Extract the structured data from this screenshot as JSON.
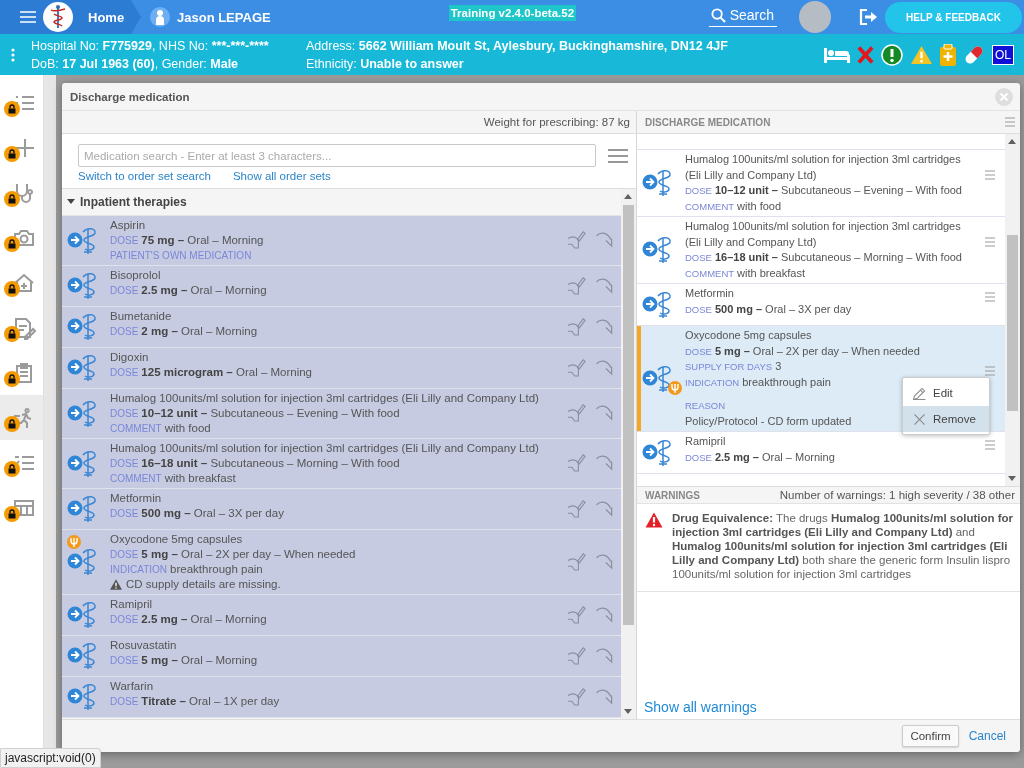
{
  "top_bar": {
    "home": "Home",
    "patient_name": "Jason LEPAGE",
    "version": "Training v2.4.0-beta.52",
    "search": "Search",
    "help_button": "HELP & FEEDBACK"
  },
  "patient_bar": {
    "columns": [
      {
        "lines": [
          [
            {
              "text": "Hospital No: ",
              "bold": false
            },
            {
              "text": "F775929",
              "bold": true
            },
            {
              "text": ", NHS No: ",
              "bold": false
            },
            {
              "text": "***-***-****",
              "bold": true
            }
          ],
          [
            {
              "text": "DoB: ",
              "bold": false
            },
            {
              "text": "17 Jul 1963 (60)",
              "bold": true
            },
            {
              "text": ", Gender: ",
              "bold": false
            },
            {
              "text": "Male",
              "bold": true
            }
          ]
        ]
      },
      {
        "lines": [
          [
            {
              "text": "Address: ",
              "bold": false
            },
            {
              "text": "5662 William Moult St, Aylesbury, Buckinghamshire, DN12 4JF",
              "bold": true
            }
          ],
          [
            {
              "text": "Ethnicity: ",
              "bold": false
            },
            {
              "text": "Unable to answer",
              "bold": true
            }
          ]
        ]
      }
    ],
    "badge": "OL"
  },
  "sidebar": {
    "items": [
      {
        "selected": false,
        "locked": true
      },
      {
        "selected": false,
        "locked": true
      },
      {
        "selected": false,
        "locked": true
      },
      {
        "selected": false,
        "locked": true
      },
      {
        "selected": false,
        "locked": true
      },
      {
        "selected": false,
        "locked": true
      },
      {
        "selected": false,
        "locked": true
      },
      {
        "selected": true,
        "locked": true
      },
      {
        "selected": false,
        "locked": true
      },
      {
        "selected": false,
        "locked": true
      }
    ]
  },
  "dialog": {
    "title": "Discharge medication",
    "weight": "Weight for prescribing: 87 kg",
    "search": {
      "placeholder": "Medication search - Enter at least 3 characters..."
    },
    "links": [
      "Switch to order set search",
      "Show all order sets"
    ],
    "therapies": {
      "label": "Inpatient therapies",
      "expanded": true,
      "items": [
        {
          "name": "Aspirin",
          "selected": true,
          "flagged": false,
          "lines": [
            {
              "kind": "dose",
              "label": "DOSE",
              "value": "**75 mg –** Oral – Morning"
            },
            {
              "kind": "tag",
              "label": "PATIENT'S OWN MEDICATION"
            }
          ]
        },
        {
          "name": "Bisoprolol",
          "selected": true,
          "flagged": false,
          "lines": [
            {
              "kind": "dose",
              "label": "DOSE",
              "value": "**2.5 mg –** Oral – Morning"
            }
          ]
        },
        {
          "name": "Bumetanide",
          "selected": true,
          "flagged": false,
          "lines": [
            {
              "kind": "dose",
              "label": "DOSE",
              "value": "**2 mg –** Oral – Morning"
            }
          ]
        },
        {
          "name": "Digoxin",
          "selected": true,
          "flagged": false,
          "lines": [
            {
              "kind": "dose",
              "label": "DOSE",
              "value": "**125 microgram –** Oral – Morning"
            }
          ]
        },
        {
          "name": "Humalog 100units/ml solution for injection 3ml cartridges (Eli Lilly and Company Ltd)",
          "selected": true,
          "flagged": false,
          "lines": [
            {
              "kind": "dose",
              "label": "DOSE",
              "value": "**10–12 unit –** Subcutaneous – Evening – With food"
            },
            {
              "kind": "note",
              "label": "COMMENT",
              "value": "with food"
            }
          ]
        },
        {
          "name": "Humalog 100units/ml solution for injection 3ml cartridges (Eli Lilly and Company Ltd)",
          "selected": true,
          "flagged": false,
          "lines": [
            {
              "kind": "dose",
              "label": "DOSE",
              "value": "**16–18 unit –** Subcutaneous – Morning – With food"
            },
            {
              "kind": "note",
              "label": "COMMENT",
              "value": "with breakfast"
            }
          ]
        },
        {
          "name": "Metformin",
          "selected": true,
          "flagged": false,
          "lines": [
            {
              "kind": "dose",
              "label": "DOSE",
              "value": "**500 mg –** Oral – 3X per day"
            }
          ]
        },
        {
          "name": "Oxycodone 5mg capsules",
          "selected": true,
          "flagged": true,
          "lines": [
            {
              "kind": "dose",
              "label": "DOSE",
              "value": "**5 mg –** Oral – 2X per day – When needed"
            },
            {
              "kind": "note",
              "label": "INDICATION",
              "value": "breakthrough pain"
            },
            {
              "kind": "alert",
              "value": "CD supply details are missing."
            }
          ]
        },
        {
          "name": "Ramipril",
          "selected": true,
          "flagged": false,
          "lines": [
            {
              "kind": "dose",
              "label": "DOSE",
              "value": "**2.5 mg –** Oral – Morning"
            }
          ]
        },
        {
          "name": "Rosuvastatin",
          "selected": true,
          "flagged": false,
          "lines": [
            {
              "kind": "dose",
              "label": "DOSE",
              "value": "**5 mg –** Oral – Morning"
            }
          ]
        },
        {
          "name": "Warfarin",
          "selected": true,
          "flagged": false,
          "lines": [
            {
              "kind": "dose",
              "label": "DOSE",
              "value": "**Titrate –** Oral – 1X per day"
            }
          ]
        }
      ]
    },
    "discharge": {
      "title": "DISCHARGE MEDICATION",
      "items": [
        {
          "name": "Humalog 100units/ml solution for injection 3ml cartridges (Eli Lilly and Company Ltd)",
          "selected": false,
          "flagged": false,
          "lines": [
            {
              "kind": "dose",
              "label": "DOSE",
              "value": "**10–12 unit –** Subcutaneous – Evening – With food"
            },
            {
              "kind": "note",
              "label": "COMMENT",
              "value": "with food"
            }
          ]
        },
        {
          "name": "Humalog 100units/ml solution for injection 3ml cartridges (Eli Lilly and Company Ltd)",
          "selected": false,
          "flagged": false,
          "lines": [
            {
              "kind": "dose",
              "label": "DOSE",
              "value": "**16–18 unit –** Subcutaneous – Morning – With food"
            },
            {
              "kind": "note",
              "label": "COMMENT",
              "value": "with breakfast"
            }
          ]
        },
        {
          "name": "Metformin",
          "selected": false,
          "flagged": false,
          "lines": [
            {
              "kind": "dose",
              "label": "DOSE",
              "value": "**500 mg –** Oral – 3X per day"
            }
          ]
        },
        {
          "name": "Oxycodone 5mg capsules",
          "selected": true,
          "flagged": true,
          "lines": [
            {
              "kind": "dose",
              "label": "DOSE",
              "value": "**5 mg –** Oral – 2X per day – When needed"
            },
            {
              "kind": "note",
              "label": "SUPPLY FOR DAYS",
              "value": "3"
            },
            {
              "kind": "note",
              "label": "INDICATION",
              "value": "breakthrough pain"
            },
            {
              "kind": "block",
              "label": "REASON",
              "value": "Policy/Protocol - CD form updated"
            }
          ]
        },
        {
          "name": "Ramipril",
          "selected": false,
          "flagged": false,
          "lines": [
            {
              "kind": "dose",
              "label": "DOSE",
              "value": "**2.5 mg –** Oral – Morning"
            }
          ]
        }
      ]
    },
    "context_menu": {
      "items": [
        {
          "label": "Edit",
          "selected": false
        },
        {
          "label": "Remove",
          "selected": true
        }
      ]
    },
    "warnings": {
      "title": "WARNINGS",
      "summary": "Number of warnings: 1 high severity / 38 other",
      "items": [
        {
          "color": "#e32028",
          "text": "**Drug Equivalence:** The drugs **Humalog 100units/ml solution for injection 3ml cartridges (Eli Lilly and Company Ltd)** and **Humalog 100units/ml solution for injection 3ml cartridges (Eli Lilly and Company Ltd)** both share the generic form Insulin lispro 100units/ml solution for injection 3ml cartridges"
        }
      ],
      "show_all": "Show all warnings"
    },
    "confirm": "Confirm",
    "cancel": "Cancel"
  },
  "status_tooltip": "javascript:void(0)"
}
